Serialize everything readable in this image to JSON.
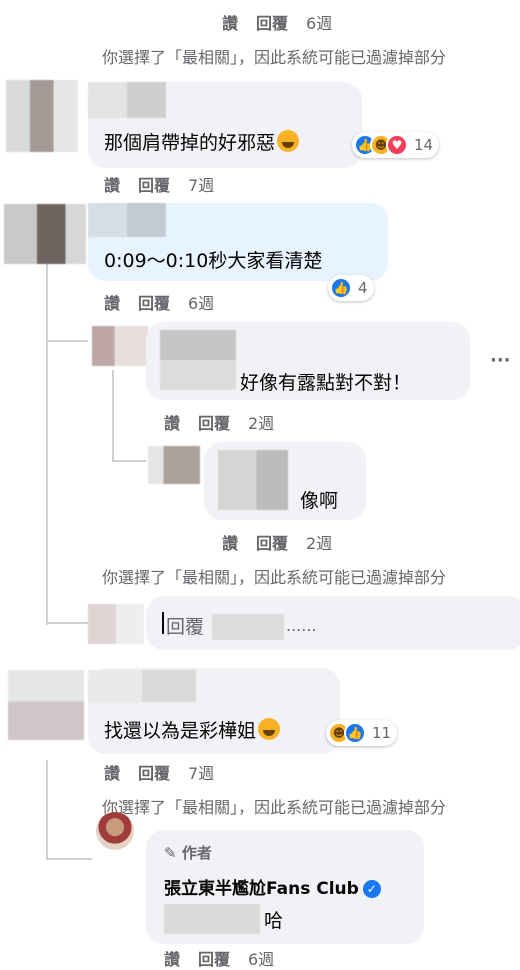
{
  "actions": {
    "like": "讚",
    "reply": "回覆"
  },
  "top": {
    "time": "6週"
  },
  "filter_notice": "你選擇了「最相關」，因此系統可能已過濾掉部分",
  "comments": [
    {
      "text": "那個肩帶掉的好邪惡",
      "time": "7週",
      "reaction_count": "14"
    },
    {
      "text": "0:09～0:10秒大家看清楚",
      "time": "6週",
      "reaction_count": "4"
    },
    {
      "text": "好像有露點對不對！",
      "time": "2週"
    },
    {
      "text": "像啊",
      "time": "2週"
    },
    {
      "text": "找還以為是彩樺姐",
      "time": "7週",
      "reaction_count": "11"
    },
    {
      "author_badge": "作者",
      "author_name": "張立東半尷尬Fans Club",
      "text": "哈",
      "time": "6週"
    }
  ],
  "reply_input": {
    "prefix": "回覆",
    "placeholder_suffix": "......"
  },
  "more_icon": "···",
  "icons": [
    "like-icon",
    "haha-icon",
    "love-icon",
    "pencil-icon",
    "verified-icon",
    "more-options-icon"
  ],
  "colors": {
    "bubble": "#f0f2f5",
    "highlight_bubble": "#e7f3ff",
    "meta": "#65676b",
    "like_blue": "#1877f2"
  }
}
